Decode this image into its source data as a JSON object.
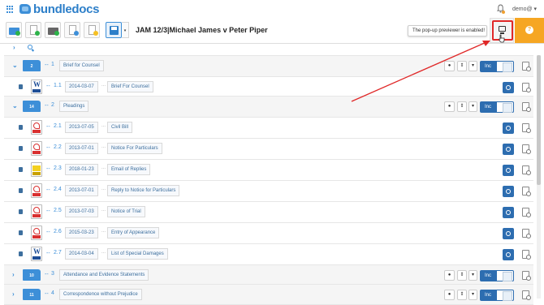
{
  "app": {
    "logo_text": "bundledocs",
    "user": "demo@ ▾"
  },
  "toolbar": {
    "case_title": "JAM 12/3|Michael James v Peter Piper",
    "tooltip": "The pop-up previewer is enabled!",
    "help_label": "?",
    "save_caret": "▾"
  },
  "sections": [
    {
      "folder_num": "2",
      "num": "1",
      "label": "Brief for Counsel",
      "expanded": true,
      "inc": "Inc"
    },
    {
      "folder_num": "14",
      "num": "2",
      "label": "Pleadings",
      "expanded": true,
      "inc": "Inc"
    },
    {
      "folder_num": "10",
      "num": "3",
      "label": "Attendance and Evidence Statements",
      "expanded": false,
      "inc": "Inc"
    },
    {
      "folder_num": "11",
      "num": "4",
      "label": "Correspondence without Prejudice",
      "expanded": false,
      "inc": "Inc"
    }
  ],
  "documents": [
    {
      "num": "1.1",
      "date": "2014-03-07",
      "title": "Brief For Counsel",
      "type": "word"
    },
    {
      "num": "2.1",
      "date": "2013-07-05",
      "title": "Civil Bill",
      "type": "pdf"
    },
    {
      "num": "2.2",
      "date": "2013-07-01",
      "title": "Notice For Particulars",
      "type": "pdf"
    },
    {
      "num": "2.3",
      "date": "2018-01-23",
      "title": "Email of Replies",
      "type": "email"
    },
    {
      "num": "2.4",
      "date": "2013-07-01",
      "title": "Reply to Notice for Particulars",
      "type": "pdf"
    },
    {
      "num": "2.5",
      "date": "2013-07-03",
      "title": "Notice of Trial",
      "type": "pdf"
    },
    {
      "num": "2.6",
      "date": "2015-03-23",
      "title": "Entry of Appearance",
      "type": "pdf"
    },
    {
      "num": "2.7",
      "date": "2014-03-04",
      "title": "List of Special Damages",
      "type": "word"
    }
  ],
  "labels": {
    "dash": "--",
    "ellipsis": "...",
    "caret_open": "⌄",
    "caret_closed": "›",
    "sort": "⇕",
    "comment": "●",
    "word_letter": "W"
  },
  "colors": {
    "accent": "#2d6db0",
    "brand": "#3d8fd8",
    "help": "#f6a623",
    "highlight": "#e02828"
  }
}
